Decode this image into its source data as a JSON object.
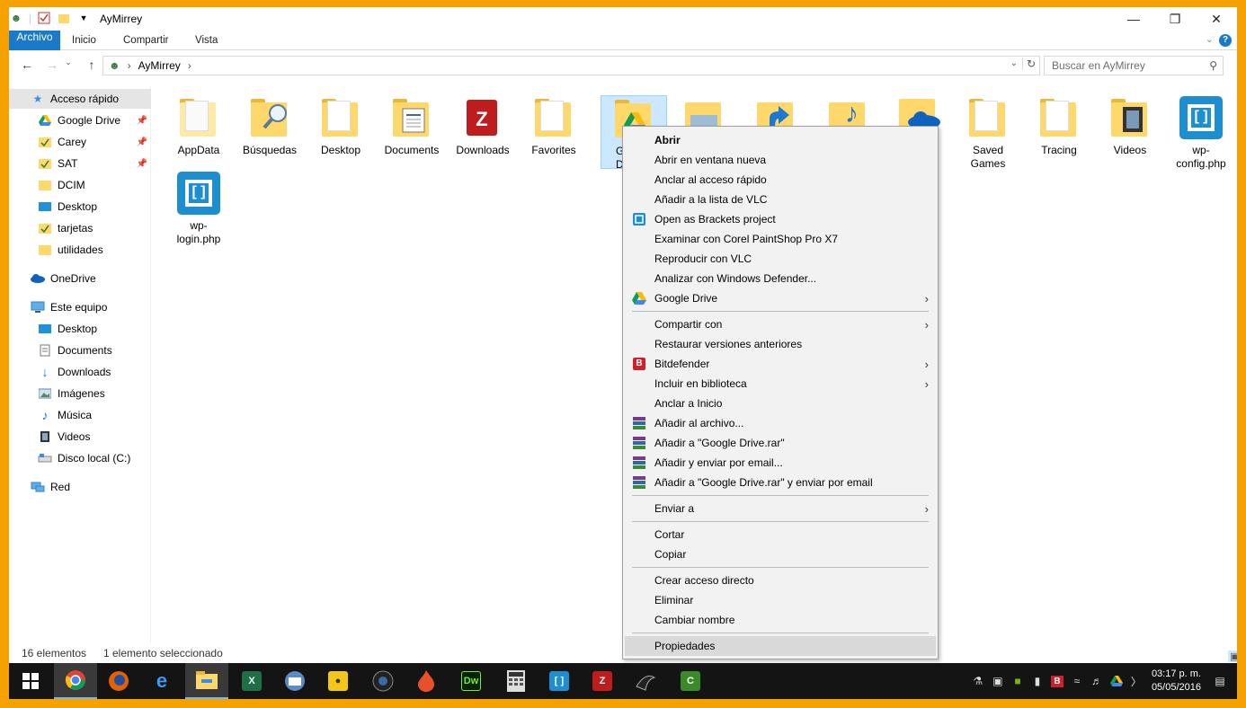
{
  "window": {
    "title": "AyMirrey",
    "ribbon_tabs": [
      "Archivo",
      "Inicio",
      "Compartir",
      "Vista"
    ]
  },
  "address": {
    "path": "AyMirrey",
    "search_placeholder": "Buscar en AyMirrey"
  },
  "sidebar": {
    "quick_access": "Acceso rápido",
    "quick_items": [
      "Google Drive",
      "Carey",
      "SAT",
      "DCIM",
      "Desktop",
      "tarjetas",
      "utilidades"
    ],
    "onedrive": "OneDrive",
    "this_pc": "Este equipo",
    "pc_items": [
      "Desktop",
      "Documents",
      "Downloads",
      "Imágenes",
      "Música",
      "Videos",
      "Disco local (C:)"
    ],
    "network": "Red"
  },
  "files": [
    {
      "name": "AppData",
      "icon": "folder-icon"
    },
    {
      "name": "Búsquedas",
      "icon": "search-folder-icon"
    },
    {
      "name": "Desktop",
      "icon": "folder-icon"
    },
    {
      "name": "Documents",
      "icon": "documents-folder-icon"
    },
    {
      "name": "Downloads",
      "icon": "filezilla-icon"
    },
    {
      "name": "Favorites",
      "icon": "folder-icon"
    },
    {
      "name": "Google Drive",
      "icon": "google-drive-folder-icon"
    },
    {
      "name": "Saved Games",
      "icon": "folder-icon"
    },
    {
      "name": "Tracing",
      "icon": "folder-icon"
    },
    {
      "name": "Videos",
      "icon": "videos-folder-icon"
    },
    {
      "name": "wp-config.php",
      "icon": "brackets-file-icon"
    },
    {
      "name": "wp-login.php",
      "icon": "brackets-file-icon"
    }
  ],
  "selected_partial": "Go\nDr",
  "status": {
    "count": "16 elementos",
    "selection": "1 elemento seleccionado"
  },
  "context_menu": {
    "items": [
      {
        "label": "Abrir",
        "bold": true
      },
      {
        "label": "Abrir en ventana nueva"
      },
      {
        "label": "Anclar al acceso rápido"
      },
      {
        "label": "Añadir a la lista de VLC"
      },
      {
        "label": "Open as Brackets project",
        "icon": "brackets-icon"
      },
      {
        "label": "Examinar con Corel PaintShop Pro X7"
      },
      {
        "label": "Reproducir con VLC"
      },
      {
        "label": "Analizar con Windows Defender..."
      },
      {
        "label": "Google Drive",
        "icon": "google-drive-icon",
        "submenu": true
      },
      {
        "label": "Compartir con",
        "submenu": true
      },
      {
        "label": "Restaurar versiones anteriores"
      },
      {
        "label": "Bitdefender",
        "icon": "bitdefender-icon",
        "submenu": true
      },
      {
        "label": "Incluir en biblioteca",
        "submenu": true
      },
      {
        "label": "Anclar a Inicio"
      },
      {
        "label": "Añadir al archivo...",
        "icon": "winrar-icon"
      },
      {
        "label": "Añadir a \"Google Drive.rar\"",
        "icon": "winrar-icon"
      },
      {
        "label": "Añadir y enviar por email...",
        "icon": "winrar-icon"
      },
      {
        "label": "Añadir a \"Google Drive.rar\" y enviar por email",
        "icon": "winrar-icon"
      },
      {
        "label": "Enviar a",
        "submenu": true
      },
      {
        "label": "Cortar"
      },
      {
        "label": "Copiar"
      },
      {
        "label": "Crear acceso directo"
      },
      {
        "label": "Eliminar"
      },
      {
        "label": "Cambiar nombre"
      },
      {
        "label": "Propiedades",
        "highlighted": true
      }
    ]
  },
  "taskbar": {
    "apps": [
      "start-icon",
      "chrome-icon",
      "firefox-icon",
      "edge-icon",
      "file-explorer-icon",
      "excel-icon",
      "thunderbird-icon",
      "bulb-app-icon",
      "camera-app-icon",
      "fire-app-icon",
      "dreamweaver-icon",
      "calculator-icon",
      "brackets-icon",
      "filezilla-icon",
      "inkscape-icon",
      "camtasia-icon"
    ],
    "time": "03:17 p. m.",
    "date": "05/05/2016"
  },
  "colors": {
    "frame": "#f5a100",
    "accent": "#1979ca",
    "selection": "#cce8ff",
    "folder": "#ffd86b"
  }
}
